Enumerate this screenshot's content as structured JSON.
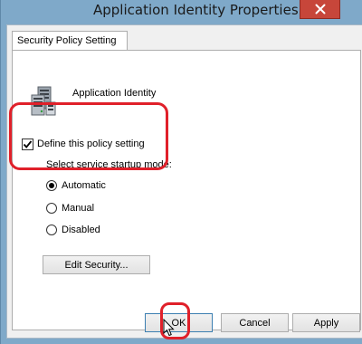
{
  "window": {
    "title": "Application Identity Properties",
    "close_glyph": "✕"
  },
  "tabs": [
    {
      "label": "Security Policy Setting",
      "selected": true
    }
  ],
  "policy": {
    "name": "Application Identity",
    "icon": "server-icon",
    "define_label": "Define this policy setting",
    "define_checked": true,
    "startup_mode_label": "Select service startup mode:",
    "options": [
      {
        "label": "Automatic",
        "selected": true
      },
      {
        "label": "Manual",
        "selected": false
      },
      {
        "label": "Disabled",
        "selected": false
      }
    ],
    "edit_security_label": "Edit Security..."
  },
  "buttons": {
    "ok": "OK",
    "cancel": "Cancel",
    "apply": "Apply"
  },
  "colors": {
    "annotation": "#e0202a",
    "close_button": "#c7463a",
    "frame": "#7fa9c9"
  }
}
